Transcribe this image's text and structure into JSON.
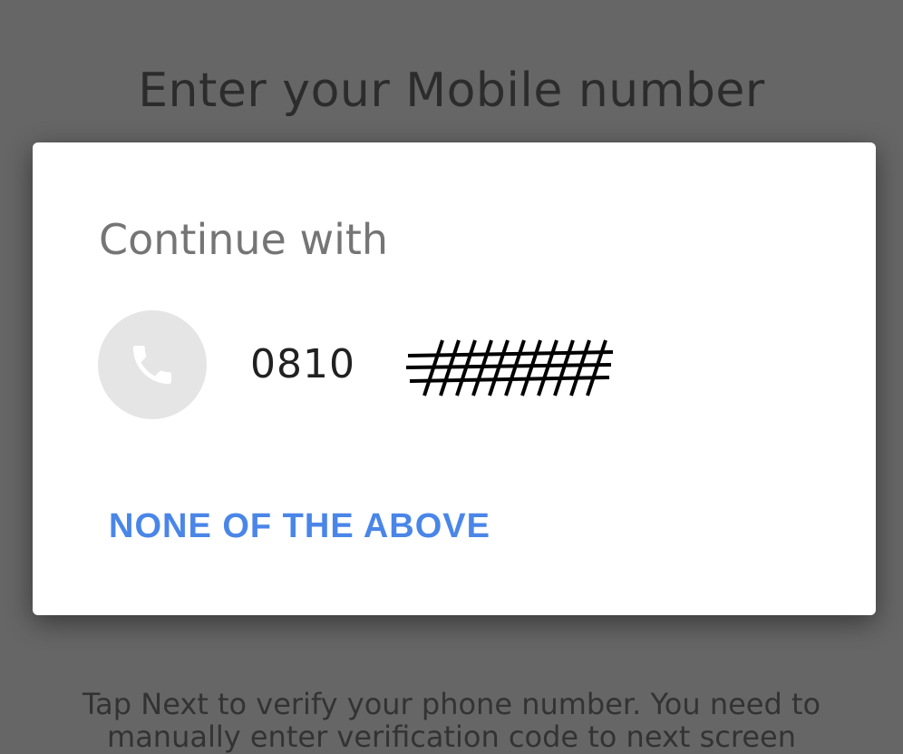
{
  "background": {
    "title": "Enter your Mobile number",
    "hint": "Tap Next to verify your phone number. You need to manually enter verification code to next screen"
  },
  "dialog": {
    "title": "Continue with",
    "option": {
      "phone_number": "0810",
      "icon": "phone-icon"
    },
    "none_button": "NONE OF THE ABOVE"
  },
  "colors": {
    "accent": "#4a86e8",
    "scrim": "#666666",
    "avatar_bg": "#e5e5e5"
  }
}
